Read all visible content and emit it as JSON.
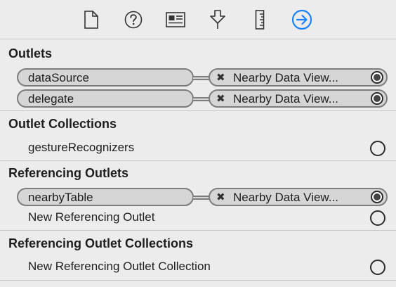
{
  "toolbar": {
    "icons": [
      "file-icon",
      "help-icon",
      "identity-icon",
      "attributes-icon",
      "size-ruler-icon",
      "connections-icon"
    ],
    "active": "connections-icon",
    "accent": "#1a82fb"
  },
  "outlets": {
    "title": "Outlets",
    "items": [
      {
        "name": "dataSource",
        "target": "Nearby Data View..."
      },
      {
        "name": "delegate",
        "target": "Nearby Data View..."
      }
    ]
  },
  "outlet_collections": {
    "title": "Outlet Collections",
    "items": [
      {
        "name": "gestureRecognizers"
      }
    ]
  },
  "referencing_outlets": {
    "title": "Referencing Outlets",
    "items": [
      {
        "name": "nearbyTable",
        "target": "Nearby Data View..."
      }
    ],
    "new_label": "New Referencing Outlet"
  },
  "referencing_outlet_collections": {
    "title": "Referencing Outlet Collections",
    "new_label": "New Referencing Outlet Collection"
  },
  "remove_glyph": "✖"
}
